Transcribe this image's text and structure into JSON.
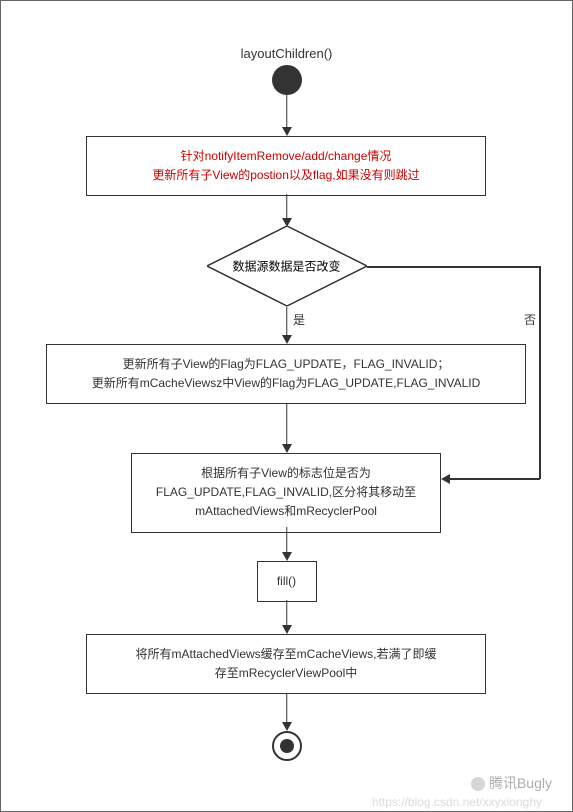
{
  "chart_data": {
    "type": "flowchart",
    "title": "layoutChildren()",
    "nodes": [
      {
        "id": "start",
        "type": "start",
        "label": "layoutChildren()"
      },
      {
        "id": "p1",
        "type": "process",
        "text_line1": "针对notifyItemRemove/add/change情况",
        "text_line2": "更新所有子View的postion以及flag,如果没有则跳过",
        "highlight": true
      },
      {
        "id": "d1",
        "type": "decision",
        "text": "数据源数据是否改变"
      },
      {
        "id": "p2",
        "type": "process",
        "text_line1": "更新所有子View的Flag为FLAG_UPDATE，FLAG_INVALID；",
        "text_line2": "更新所有mCacheViewsz中View的Flag为FLAG_UPDATE,FLAG_INVALID"
      },
      {
        "id": "p3",
        "type": "process",
        "text_line1": "根据所有子View的标志位是否为",
        "text_line2": "FLAG_UPDATE,FLAG_INVALID,区分将其移动至",
        "text_line3": "mAttachedViews和mRecyclerPool"
      },
      {
        "id": "p4",
        "type": "process",
        "text": "fill()"
      },
      {
        "id": "p5",
        "type": "process",
        "text_line1": "将所有mAttachedViews缓存至mCacheViews,若满了即缓",
        "text_line2": "存至mRecyclerViewPool中"
      },
      {
        "id": "end",
        "type": "end"
      }
    ],
    "edges": [
      {
        "from": "start",
        "to": "p1"
      },
      {
        "from": "p1",
        "to": "d1"
      },
      {
        "from": "d1",
        "to": "p2",
        "label": "是"
      },
      {
        "from": "d1",
        "to": "p3",
        "label": "否"
      },
      {
        "from": "p2",
        "to": "p3"
      },
      {
        "from": "p3",
        "to": "p4"
      },
      {
        "from": "p4",
        "to": "p5"
      },
      {
        "from": "p5",
        "to": "end"
      }
    ],
    "labels": {
      "yes": "是",
      "no": "否"
    }
  },
  "watermark": {
    "brand": "腾讯Bugly",
    "url": "https://blog.csdn.net/xxyxionghy"
  }
}
